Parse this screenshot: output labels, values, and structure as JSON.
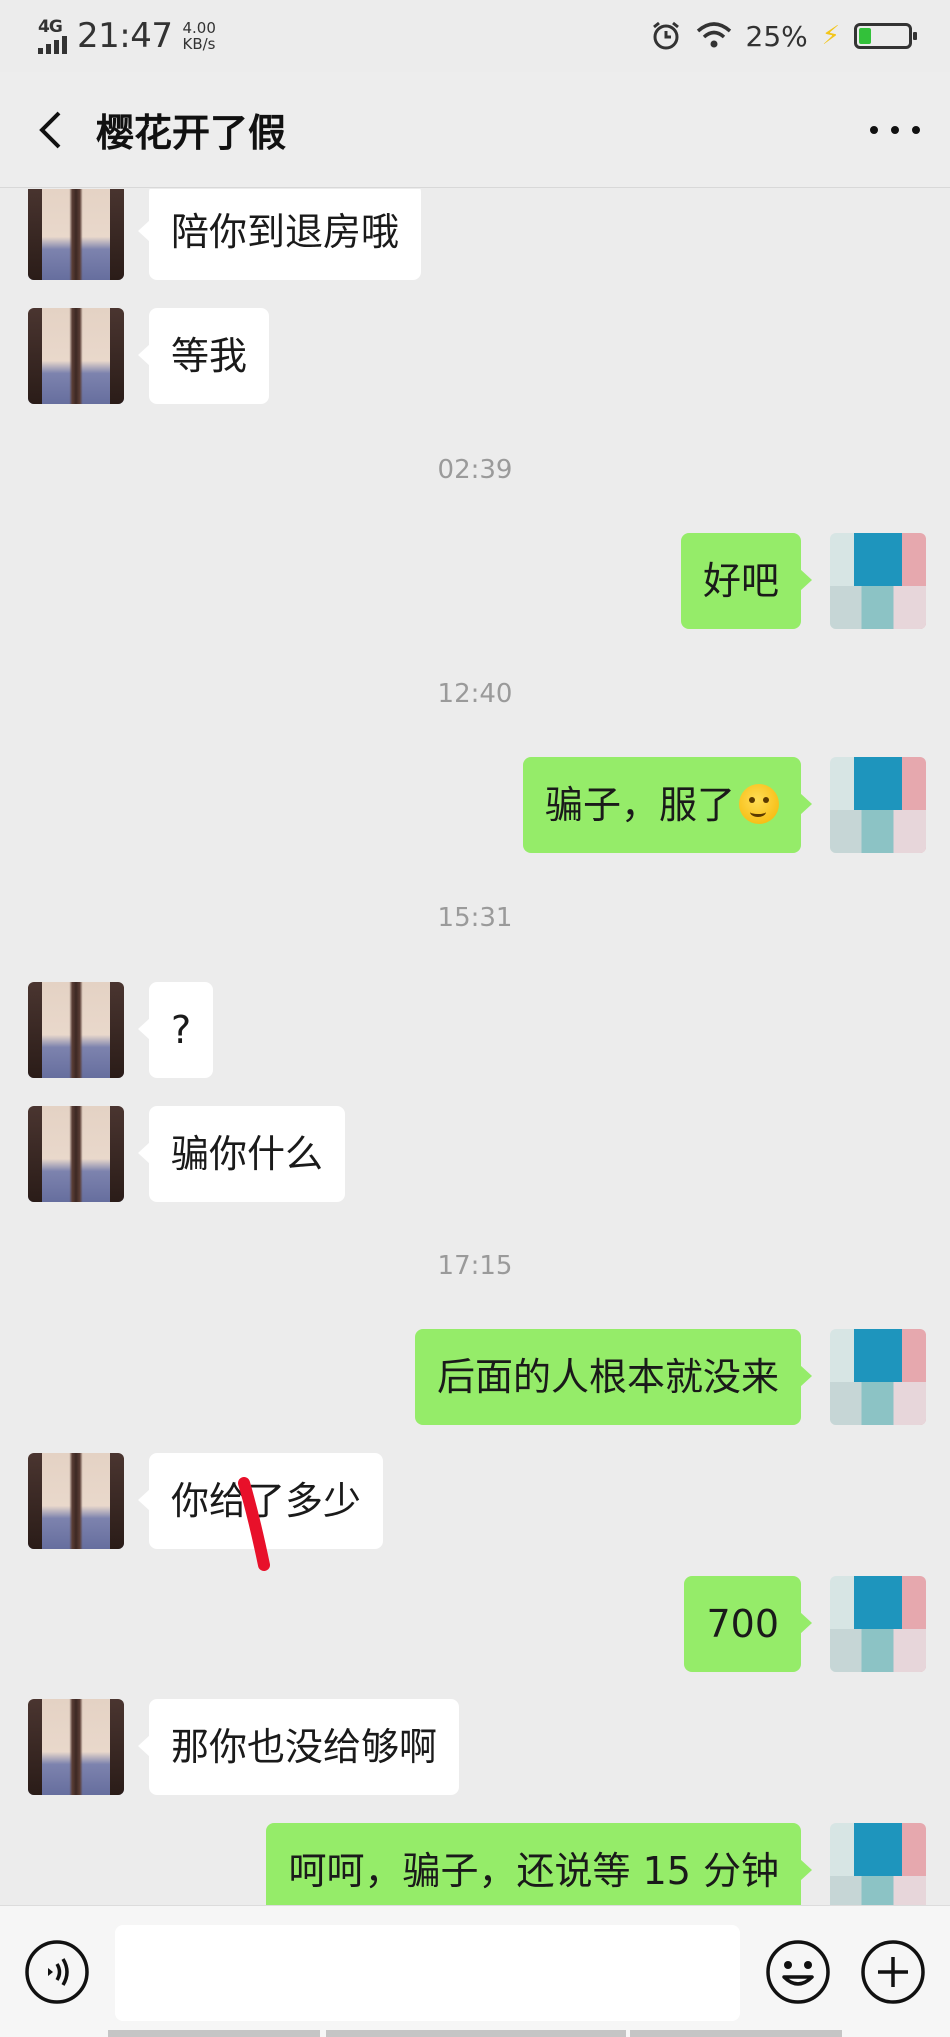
{
  "status_bar": {
    "network": "4G",
    "time": "21:47",
    "speed_value": "4.00",
    "speed_unit": "KB/s",
    "battery_percent": "25%",
    "battery_level": 0.25,
    "icons": [
      "signal-icon",
      "alarm-icon",
      "wifi-icon",
      "charging-icon",
      "battery-icon"
    ]
  },
  "header": {
    "title": "樱花开了假",
    "back_icon": "chevron-left-icon",
    "more_icon": "more-dots-icon"
  },
  "messages": [
    {
      "side": "left",
      "text": "陪你到退房哦"
    },
    {
      "side": "left",
      "text": "等我"
    },
    {
      "timestamp": "02:39"
    },
    {
      "side": "right",
      "text": "好吧"
    },
    {
      "timestamp": "12:40"
    },
    {
      "side": "right",
      "text": "骗子，服了",
      "emoji": "hand-over-mouth-emoji"
    },
    {
      "timestamp": "15:31"
    },
    {
      "side": "left",
      "text": "?"
    },
    {
      "side": "left",
      "text": "骗你什么"
    },
    {
      "timestamp": "17:15"
    },
    {
      "side": "right",
      "text": "后面的人根本就没来"
    },
    {
      "side": "left",
      "text": "你给了多少"
    },
    {
      "side": "right",
      "text": "700"
    },
    {
      "side": "left",
      "text": "那你也没给够啊"
    },
    {
      "side": "right",
      "text": "呵呵，骗子，还说等 15 分钟"
    }
  ],
  "input_bar": {
    "placeholder": "",
    "icons": [
      "voice-icon",
      "emoji-icon",
      "plus-icon"
    ]
  },
  "colors": {
    "background": "#ececec",
    "self_bubble": "#95ec69",
    "other_bubble": "#ffffff",
    "timestamp": "#9a9a9a",
    "annotation_red": "#e8102a"
  }
}
